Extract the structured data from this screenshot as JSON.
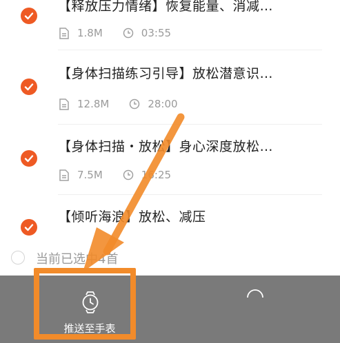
{
  "tracks": [
    {
      "title": "【释放压力情绪】恢复能量、消减…",
      "size": "1.8M",
      "duration": "03:55",
      "selected": true
    },
    {
      "title": "【身体扫描练习引导】放松潜意识…",
      "size": "12.8M",
      "duration": "28:00",
      "selected": true
    },
    {
      "title": "【身体扫描・放松】身心深度放松…",
      "size": "7.5M",
      "duration": "16:25",
      "selected": true
    },
    {
      "title": "【倾听海浪】放松、减压",
      "selected": true
    }
  ],
  "selection": {
    "status_text": "当前已选中4首"
  },
  "bottom_bar": {
    "push_label": "推送至手表"
  },
  "icons": {
    "check": "check-circle-icon",
    "file": "file-icon",
    "clock": "clock-icon",
    "watch": "watch-icon"
  },
  "colors": {
    "accent": "#ee5a24",
    "annotation": "#f28b2a",
    "bottom_bar": "#7a7a7a"
  }
}
